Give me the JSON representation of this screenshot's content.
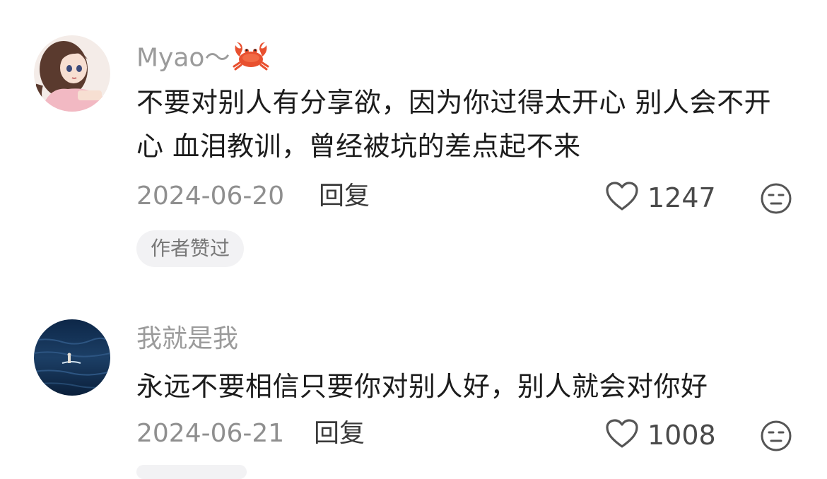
{
  "comments": [
    {
      "username": "Myao～",
      "username_emoji": "crab-icon",
      "text": "不要对别人有分享欲，因为你过得太开心 别人会不开心 血泪教训，曾经被坑的差点起不来",
      "date": "2024-06-20",
      "reply_label": "回复",
      "likes": "1247",
      "badge": "作者赞过"
    },
    {
      "username": "我就是我",
      "text": "永远不要相信只要你对别人好，别人就会对你好",
      "date": "2024-06-21",
      "reply_label": "回复",
      "likes": "1008"
    }
  ],
  "colors": {
    "username": "#9b9b9b",
    "badge_bg": "#f2f2f4",
    "icon": "#555555"
  }
}
